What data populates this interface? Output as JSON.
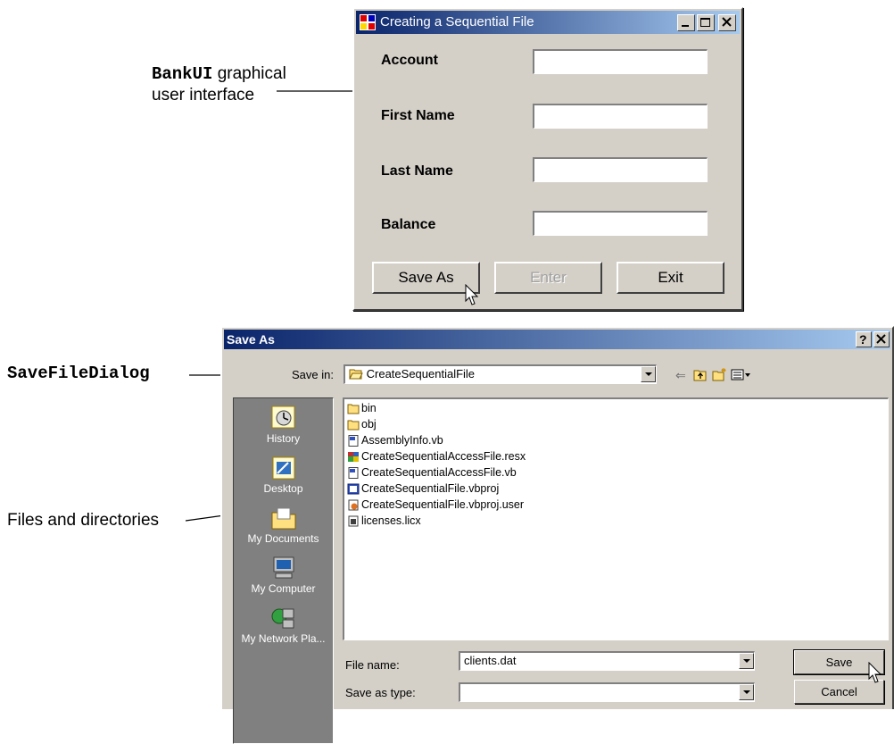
{
  "annotations": {
    "bankui_code": "BankUI",
    "bankui_text1": "graphical",
    "bankui_text2": "user interface",
    "savefiledialog": "SaveFileDialog",
    "files_dirs": "Files and directories"
  },
  "bank_window": {
    "title": "Creating a Sequential File",
    "fields": {
      "account": "Account",
      "first_name": "First Name",
      "last_name": "Last Name",
      "balance": "Balance"
    },
    "buttons": {
      "save_as": "Save As",
      "enter": "Enter",
      "exit": "Exit"
    }
  },
  "save_dialog": {
    "title": "Save As",
    "save_in_label": "Save in:",
    "save_in_value": "CreateSequentialFile",
    "places": {
      "history": "History",
      "desktop": "Desktop",
      "my_documents": "My Documents",
      "my_computer": "My Computer",
      "my_network": "My Network Pla..."
    },
    "files": [
      {
        "name": "bin",
        "icon": "folder-icon"
      },
      {
        "name": "obj",
        "icon": "folder-icon"
      },
      {
        "name": "AssemblyInfo.vb",
        "icon": "vb-file-icon"
      },
      {
        "name": "CreateSequentialAccessFile.resx",
        "icon": "resx-file-icon"
      },
      {
        "name": "CreateSequentialAccessFile.vb",
        "icon": "vb-file-icon"
      },
      {
        "name": "CreateSequentialFile.vbproj",
        "icon": "vbproj-file-icon"
      },
      {
        "name": "CreateSequentialFile.vbproj.user",
        "icon": "user-file-icon"
      },
      {
        "name": "licenses.licx",
        "icon": "licx-file-icon"
      }
    ],
    "file_name_label": "File name:",
    "file_name_value": "clients.dat",
    "save_type_label": "Save as type:",
    "save_type_value": "",
    "save_button": "Save",
    "cancel_button": "Cancel"
  },
  "colors": {
    "title_start": "#0a246a",
    "title_end": "#a6caf0",
    "face": "#d4d0c8",
    "places_bg": "#808080"
  }
}
